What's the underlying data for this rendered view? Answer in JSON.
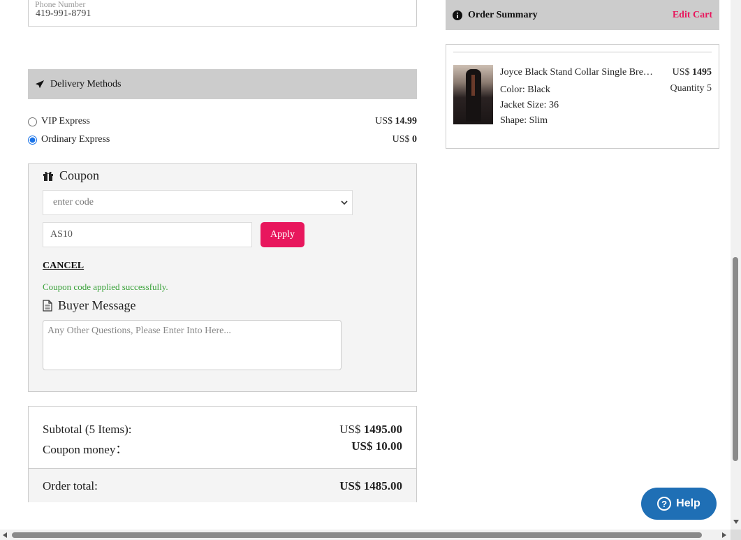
{
  "shipping": {
    "phone_label": "Phone Number",
    "phone_value": "419-991-8791"
  },
  "delivery": {
    "header": "Delivery Methods",
    "icon": "airplane-icon",
    "methods": [
      {
        "label": "VIP Express",
        "currency": "US$",
        "price": "14.99",
        "selected": false
      },
      {
        "label": "Ordinary Express",
        "currency": "US$",
        "price": "0",
        "selected": true
      }
    ]
  },
  "coupon": {
    "title": "Coupon",
    "icon": "gift-icon",
    "select_value": "enter code",
    "input_value": "AS10",
    "apply_label": "Apply",
    "cancel_label": "CANCEL",
    "success_message": "Coupon code applied successfully.",
    "success_color": "#3aa23a"
  },
  "buyer_message": {
    "title": "Buyer Message",
    "icon": "document-icon",
    "placeholder": "Any Other Questions, Please Enter Into Here..."
  },
  "totals": {
    "subtotal_label": "Subtotal (5 Items):",
    "subtotal_currency": "US$",
    "subtotal_value": "1495.00",
    "coupon_label": "Coupon money：",
    "coupon_value": "US$ 10.00",
    "order_total_label": "Order total:",
    "order_total_value": "US$ 1485.00"
  },
  "order_summary": {
    "title": "Order Summary",
    "icon": "info-icon",
    "edit_cart": "Edit Cart",
    "accent_color": "#e8175d",
    "item": {
      "name": "Joyce Black Stand Collar Single Breasted Suit",
      "color": "Color: Black",
      "jacket_size": "Jacket Size: 36",
      "shape": "Shape: Slim",
      "currency": "US$",
      "price": "1495",
      "quantity": "Quantity 5"
    }
  },
  "help": {
    "label": "Help",
    "icon": "question-circle-icon",
    "color": "#1f6fb5"
  }
}
